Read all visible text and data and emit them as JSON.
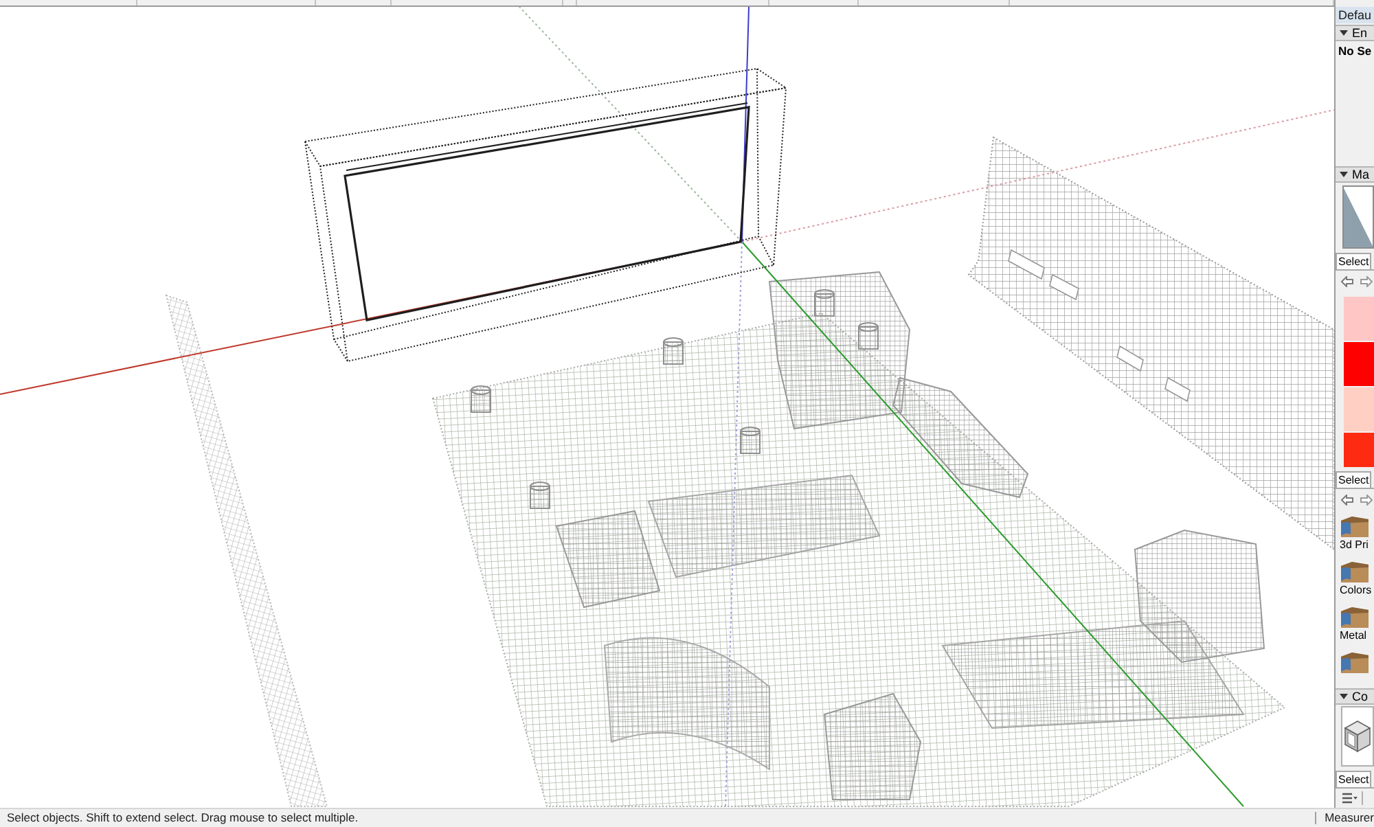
{
  "tray": {
    "title": "Defau",
    "entity_info": {
      "title": "En",
      "expanded": true,
      "status": "No Se"
    },
    "materials": {
      "title": "Ma",
      "expanded": true,
      "tabs": [
        {
          "label": "Select",
          "selected": true
        }
      ],
      "swatches": [
        {
          "color": "#ffc6c6"
        },
        {
          "color": "#ff0000"
        },
        {
          "color": "#ffcfc4"
        },
        {
          "color": "#ff2a12"
        }
      ],
      "library_tabs": [
        {
          "label": "Select",
          "selected": true
        }
      ],
      "libraries": [
        {
          "kind": "folder",
          "name": "3d Pri"
        },
        {
          "kind": "folder",
          "name": "Colors"
        },
        {
          "kind": "folder",
          "name": "Metal"
        },
        {
          "kind": "folder"
        }
      ]
    },
    "components": {
      "title": "Co",
      "expanded": true,
      "tabs": [
        {
          "label": "Select",
          "selected": true
        }
      ]
    }
  },
  "status_bar": {
    "hint": "Select objects. Shift to extend select. Drag mouse to select multiple.",
    "measurements_label": "Measurer"
  }
}
